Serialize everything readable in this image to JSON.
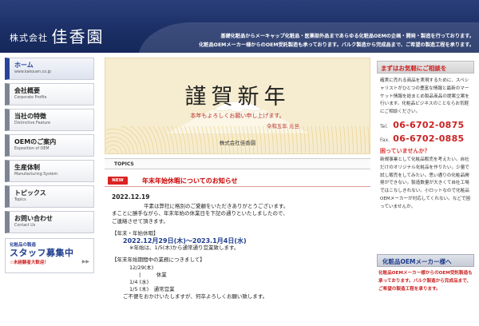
{
  "header": {
    "logo_small": "株式会社",
    "logo_big": "佳香園",
    "tagline_1": "基礎化粧品からメーキャップ化粧品・医薬部外品まであらゆる化粧品OEMの企画・開発・製造を行っております。",
    "tagline_2": "化粧品OEMメーカー様からのOEM受託製造も承っております。バルク製造から完成品まで、ご希望の製造工程を承ります。"
  },
  "nav": [
    {
      "jp": "ホーム",
      "en": "www.kakouen.co.jp"
    },
    {
      "jp": "会社概要",
      "en": "Corporate Profile"
    },
    {
      "jp": "当社の特徴",
      "en": "Distinctive Feature"
    },
    {
      "jp": "OEMのご案内",
      "en": "Exposition of OEM"
    },
    {
      "jp": "生産体制",
      "en": "Manufacturing System"
    },
    {
      "jp": "トピックス",
      "en": "Topics"
    },
    {
      "jp": "お問い合わせ",
      "en": "Contact Us"
    }
  ],
  "recruit": {
    "line1": "化粧品の製造",
    "line2": "スタッフ募集中",
    "line3": "☆未経験者大歓迎！",
    "arrow": "▶▶"
  },
  "greeting": {
    "title": "謹賀新年",
    "message": "本年もよろしくお願い申し上げます。",
    "era": "令和五年 元旦",
    "company": "株式会社佳香園"
  },
  "topics": {
    "label": "TOPICS",
    "badge": "NEW",
    "title": "年末年始休暇についてのお知らせ",
    "date": "2022.12.19",
    "p1": "平素は弊社に格別のご愛顧をいただきありがとうございます。",
    "p2": "まことに勝手ながら、年末年始の休業日を下記の通りといたしましたので、",
    "p3": "ご連絡させて頂きます。",
    "holiday_label": "【年末・年始休暇】",
    "holiday_dates": "2022.12月29日(木)～2023.1月4日(水)",
    "holiday_note": "※年始は、1/5(木)から通常通り営業致します。",
    "schedule_label": "【年末年始期間中の業務につきまして】",
    "s1": "12/29(木)",
    "s2": "|　　　休業",
    "s3": "1/4 (水)",
    "s4": "1/5 (木)　通常営業",
    "closing": "ご不便をおかけいたしますが、何卒よろしくお願い致します。"
  },
  "right": {
    "consult_title": "まずはお気軽にご相談を",
    "consult_text": "確実に売れる商品を実現するために、スペシャリストがひとつの豊富な情報と最新のマーケット情報を総まとめ製品商品の提案立案を行います。化粧品ビジネスのことならお気軽にご相談ください。",
    "tel_label": "Tel.",
    "tel": "06-6702-0875",
    "fax_label": "Fax.",
    "fax": "06-6702-0885",
    "trouble_title": "困っていませんか？",
    "trouble_text": "新規事業として化粧品販売を考えたい。自社だけのオリジナル化粧品を作りたい。少量で試し販売をしてみたい。思い通りの化粧品開発ができない。製造数量が大きくて自社工場ではこなしきれない。小ロットなので化粧品OEMメーカーが対応してくれない。などで困っていませんか。",
    "oem_title": "化粧品OEMメーカー様へ",
    "oem_text": "化粧品OEMメーカー様からのOEM受託製造も承っております。バルク製造から完成品まで、ご希望の製造工程を承ります。"
  }
}
